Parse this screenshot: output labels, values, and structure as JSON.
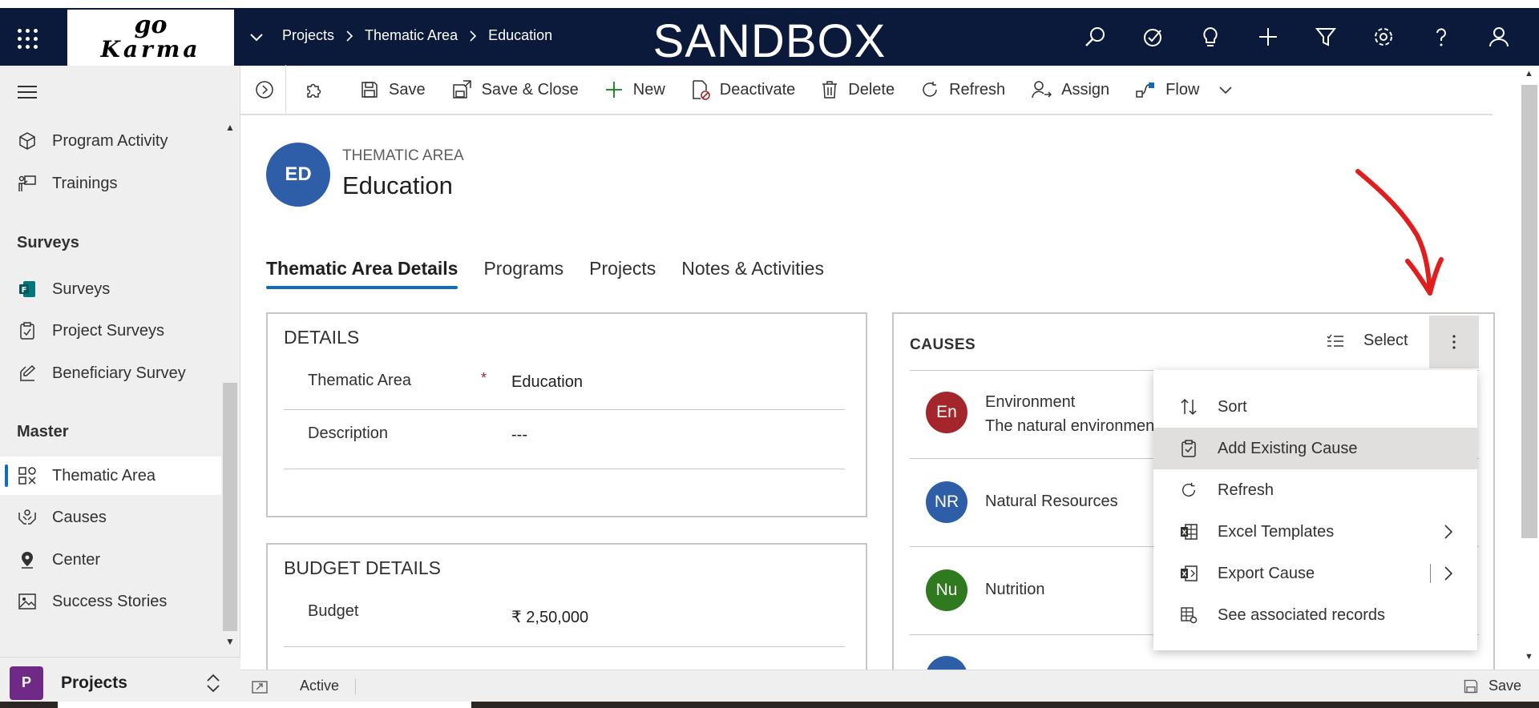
{
  "header": {
    "breadcrumbs": [
      "Projects",
      "Thematic Area",
      "Education"
    ],
    "environment": "SANDBOX",
    "logo_top": "go",
    "logo_bottom": "Karma"
  },
  "sidebar": {
    "items_top": [
      {
        "label": "Program Activity",
        "icon": "cube-icon"
      },
      {
        "label": "Trainings",
        "icon": "training-icon"
      }
    ],
    "groups": [
      {
        "title": "Surveys",
        "items": [
          {
            "label": "Surveys",
            "icon": "forms-icon"
          },
          {
            "label": "Project Surveys",
            "icon": "clipboard-icon"
          },
          {
            "label": "Beneficiary Survey",
            "icon": "survey-icon"
          }
        ]
      },
      {
        "title": "Master",
        "items": [
          {
            "label": "Thematic Area",
            "icon": "grid-icon",
            "selected": true
          },
          {
            "label": "Causes",
            "icon": "hands-icon"
          },
          {
            "label": "Center",
            "icon": "location-icon"
          },
          {
            "label": "Success Stories",
            "icon": "image-icon"
          }
        ]
      }
    ],
    "area_badge": "P",
    "area_label": "Projects"
  },
  "commandbar": {
    "save": "Save",
    "save_close": "Save & Close",
    "new": "New",
    "deactivate": "Deactivate",
    "delete": "Delete",
    "refresh": "Refresh",
    "assign": "Assign",
    "flow": "Flow"
  },
  "record": {
    "avatar": "ED",
    "entity": "THEMATIC AREA",
    "title": "Education"
  },
  "tabs": [
    "Thematic Area Details",
    "Programs",
    "Projects",
    "Notes & Activities"
  ],
  "details": {
    "heading": "DETAILS",
    "thematic_label": "Thematic Area",
    "required_mark": "*",
    "thematic_value": "Education",
    "description_label": "Description",
    "description_value": "---"
  },
  "budget": {
    "heading": "BUDGET DETAILS",
    "budget_label": "Budget",
    "budget_value": "₹ 2,50,000"
  },
  "causes": {
    "heading": "CAUSES",
    "select_label": "Select",
    "rows": [
      {
        "initials": "En",
        "name": "Environment",
        "desc": "The natural environment",
        "color": "#a4262c"
      },
      {
        "initials": "NR",
        "name": "Natural Resources",
        "desc": "",
        "color": "#2e5ea8"
      },
      {
        "initials": "Nu",
        "name": "Nutrition",
        "desc": "",
        "color": "#2f7a1f"
      }
    ]
  },
  "menu": {
    "items": [
      {
        "label": "Sort",
        "icon": "sort-icon"
      },
      {
        "label": "Add Existing Cause",
        "icon": "add-existing-icon"
      },
      {
        "label": "Refresh",
        "icon": "refresh-icon"
      },
      {
        "label": "Excel Templates",
        "icon": "excel-icon"
      },
      {
        "label": "Export Cause",
        "icon": "export-icon"
      },
      {
        "label": "See associated records",
        "icon": "records-icon"
      }
    ]
  },
  "status": {
    "state": "Active",
    "save": "Save"
  },
  "colors": {
    "header_bg": "#0b1a3b",
    "accent": "#0f6cbd",
    "annotation_arrow": "#e11d1d"
  }
}
